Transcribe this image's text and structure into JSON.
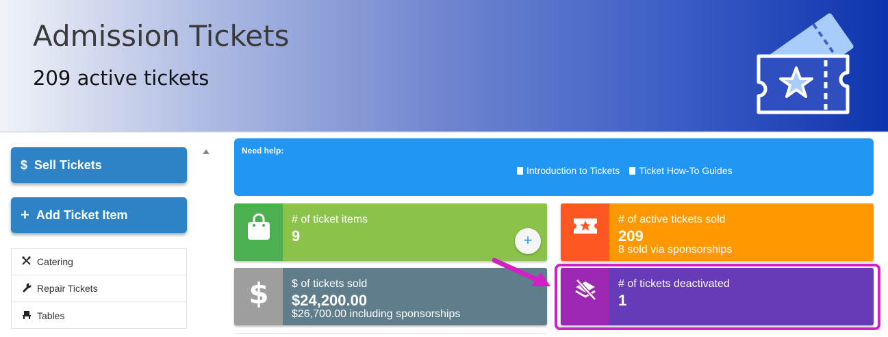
{
  "header": {
    "title": "Admission Tickets",
    "subtitle": "209 active tickets",
    "art_icon": "ticket-star-icon"
  },
  "sidebar": {
    "buttons": [
      {
        "label": "Sell Tickets",
        "icon": "$"
      },
      {
        "label": "Add Ticket Item",
        "icon": "+"
      }
    ],
    "items": [
      {
        "label": "Catering",
        "icon": "utensils-icon"
      },
      {
        "label": "Repair Tickets",
        "icon": "wrench-icon"
      },
      {
        "label": "Tables",
        "icon": "chair-icon"
      }
    ]
  },
  "help": {
    "title": "Need help:",
    "links": [
      {
        "label": "Introduction to Tickets",
        "icon": "book-icon"
      },
      {
        "label": "Ticket How-To Guides",
        "icon": "book-icon"
      }
    ]
  },
  "cards": [
    {
      "label": "# of ticket items",
      "value": "9",
      "sub": "",
      "icon": "shopping-bag-icon"
    },
    {
      "label": "# of active tickets sold",
      "value": "209",
      "sub": "8 sold via sponsorships",
      "icon": "ticket-icon"
    },
    {
      "label": "$ of tickets sold",
      "value": "$24,200.00",
      "sub": "$26,700.00 including sponsorships",
      "icon": "dollar-icon"
    },
    {
      "label": "# of tickets deactivated",
      "value": "1",
      "sub": "",
      "icon": "deactivated-layers-icon"
    }
  ],
  "add_button": "+",
  "colors": {
    "help_bg": "#2196f3",
    "card_green": "#8bc34a",
    "card_orange": "#ff9800",
    "card_slate": "#607d8b",
    "card_purple": "#673ab7",
    "highlight": "#d41ec8",
    "sidebar_button": "#2e83c6"
  }
}
